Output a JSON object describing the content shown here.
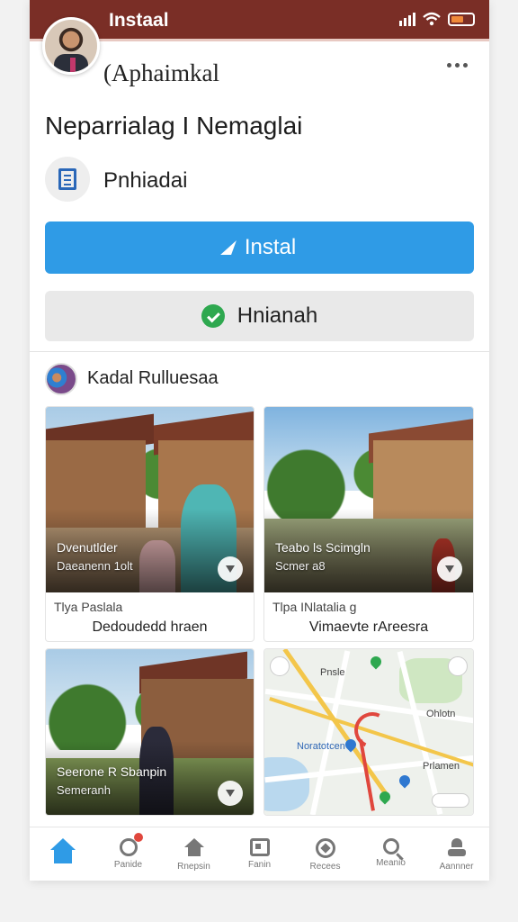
{
  "status_bar": {
    "title": "Instaal",
    "color": "#7a2e26"
  },
  "app": {
    "name": "(Aphaimkal",
    "headline": "Neparrialag I Nemaglai",
    "publisher": "Pnhiadai"
  },
  "buttons": {
    "install_label": "Instal",
    "secondary_label": "Hnianah",
    "install_color": "#2f9be6"
  },
  "section": {
    "title": "Kadal Rulluesaa"
  },
  "cards": [
    {
      "caption_title": "Dvenutlder",
      "caption_sub": "Daeanenn 1olt",
      "label": "Tlya Paslala",
      "value": "Dedoudedd hraen"
    },
    {
      "caption_title": "Teabo ls Scimgln",
      "caption_sub": "Scmer a8",
      "label": "Tlpa INlatalia g",
      "value": "Vimaevte rAreesra"
    },
    {
      "caption_title": "Seerone R Sbanpin",
      "caption_sub": "Semeranh"
    },
    {
      "map_labels": [
        "Pnsle",
        "Noratotcen",
        "Ohlotn",
        "Prlamen"
      ]
    }
  ],
  "bottom_nav": [
    {
      "icon": "home-icon",
      "label": ""
    },
    {
      "icon": "search-dot-icon",
      "label": "Panide"
    },
    {
      "icon": "house-icon",
      "label": "Rnepsin"
    },
    {
      "icon": "calendar-icon",
      "label": "Fanin"
    },
    {
      "icon": "compass-icon",
      "label": "Recees"
    },
    {
      "icon": "magnifier-icon",
      "label": "Meanio"
    },
    {
      "icon": "profile-icon",
      "label": "Aannner"
    }
  ]
}
